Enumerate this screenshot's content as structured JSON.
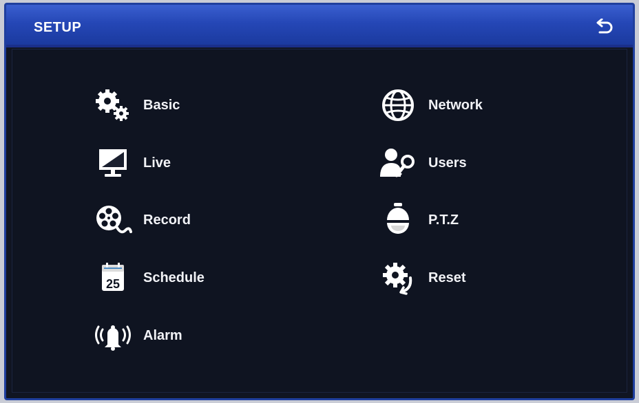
{
  "header": {
    "title": "SETUP",
    "back_icon": "back-arrow-icon"
  },
  "menu": {
    "left": [
      {
        "label": "Basic",
        "icon": "gears-icon"
      },
      {
        "label": "Live",
        "icon": "monitor-icon"
      },
      {
        "label": "Record",
        "icon": "film-reel-icon"
      },
      {
        "label": "Schedule",
        "icon": "calendar-icon",
        "icon_text": "25"
      },
      {
        "label": "Alarm",
        "icon": "alarm-bell-icon"
      }
    ],
    "right": [
      {
        "label": "Network",
        "icon": "globe-icon"
      },
      {
        "label": "Users",
        "icon": "users-key-icon"
      },
      {
        "label": "P.T.Z",
        "icon": "ptz-camera-icon"
      },
      {
        "label": "Reset",
        "icon": "reset-gear-icon"
      }
    ]
  },
  "colors": {
    "titlebar": "#2547b6",
    "background": "#101522",
    "text": "#ffffff"
  }
}
